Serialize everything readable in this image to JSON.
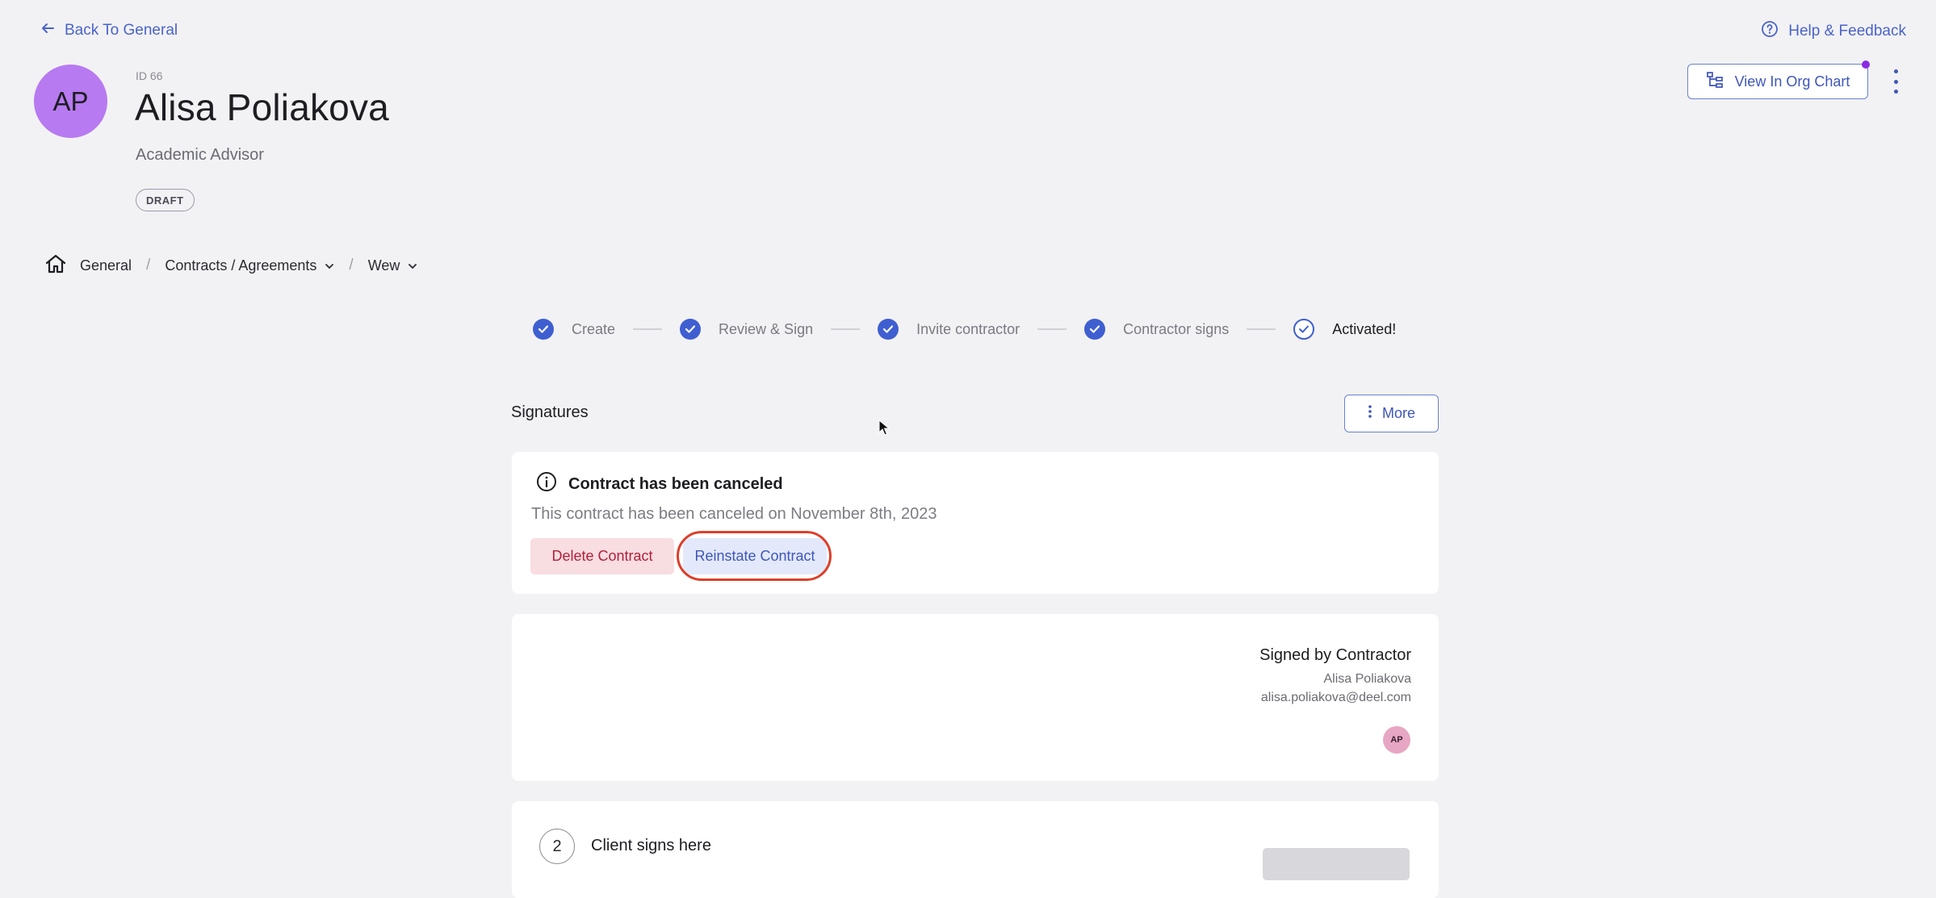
{
  "top": {
    "back_label": "Back To General",
    "help_label": "Help & Feedback"
  },
  "profile": {
    "initials": "AP",
    "id_label": "ID 66",
    "name": "Alisa Poliakova",
    "role": "Academic Advisor",
    "status": "DRAFT"
  },
  "actions": {
    "org_chart_label": "View In Org Chart"
  },
  "breadcrumb": {
    "items": [
      "General",
      "Contracts / Agreements",
      "Wew"
    ]
  },
  "stepper": {
    "steps": [
      "Create",
      "Review & Sign",
      "Invite contractor",
      "Contractor signs",
      "Activated!"
    ]
  },
  "signatures": {
    "title": "Signatures",
    "more_label": "More",
    "cancel": {
      "title": "Contract has been canceled",
      "text": "This contract has been canceled on November 8th, 2023",
      "delete_label": "Delete Contract",
      "reinstate_label": "Reinstate Contract"
    },
    "contractor": {
      "title": "Signed by Contractor",
      "name": "Alisa Poliakova",
      "email": "alisa.poliakova@deel.com",
      "initials": "AP"
    },
    "client": {
      "step_number": "2",
      "label": "Client signs here"
    }
  },
  "colors": {
    "accent": "#3f5fd1",
    "avatar": "#b77af0",
    "delete_bg": "#f8dde1",
    "delete_text": "#b3203a",
    "highlight_ring": "#dc3f2a"
  }
}
